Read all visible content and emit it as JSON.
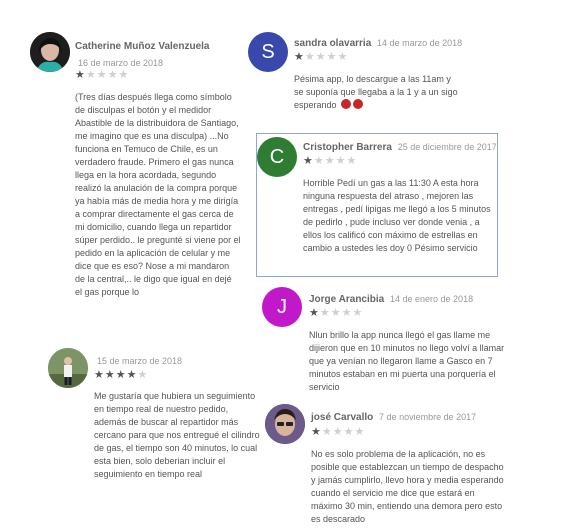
{
  "reviews": [
    {
      "name": "Catherine Muñoz Valenzuela",
      "date": "16 de marzo de 2018",
      "stars": 1,
      "text": "(Tres días después llega como símbolo de disculpas el botón y el medidor Abastible de la distribuidora de Santiago, me imagino que es una disculpa) ...No funciona en Temuco de Chile, es un verdadero fraude. Primero el gas nunca llega en la hora acordada, segundo realizó la anulación de la compra porque ya había más de media hora y me dirigía a comprar directamente el gas cerca de mi domicilio, cuando llega un repartidor súper perdido.. le pregunté si viene por el pedido en la aplicación de celular y me dice que es eso? Nose a mi mandaron de la central,.. le digo que igual en dejé el gas porque lo"
    },
    {
      "name": "",
      "date": "15 de marzo de 2018",
      "stars": 4,
      "text": "Me gustaría que hubiera un seguimiento en tiempo real de nuestro pedido, además de buscar al repartidor más cercano para que nos entregué el cilindro de gas, el tiempo son 40 minutos, lo cual esta bien, solo deberian incluir el seguimiento en tiempo real"
    },
    {
      "name": "sandra olavarria",
      "date": "14 de marzo de 2018",
      "stars": 1,
      "avatar_letter": "S",
      "avatar_color": "#3949ab",
      "text": "Pésima app, lo descargue a las 11am y se suponía que llegaba a la 1 y a un sigo esperando"
    },
    {
      "name": "Cristopher Barrera",
      "date": "25 de diciembre de 2017",
      "stars": 1,
      "avatar_letter": "C",
      "avatar_color": "#2e7d32",
      "text": "Horrible Pedí un gas a las 11:30 A esta hora ninguna respuesta del atraso , mejoren las entregas , pedí lipigas me llegó a los 5 minutos de pedirlo , pude incluso ver donde venia , a ellos los calificó con máximo de estrellas en cambio a ustedes les doy 0 Pésimo servicio"
    },
    {
      "name": "Jorge Arancibia",
      "date": "14 de enero de 2018",
      "stars": 1,
      "avatar_letter": "J",
      "avatar_color": "#c118c9",
      "text": "Nlun brillo la app nunca llegó el gas llame me dijieron que en 10 minutos no llego volví a llamar que ya venían no llegaron llame a Gasco en 7 minutos estaban en mi puerta una porquería el servicio"
    },
    {
      "name": "josé Carvallo",
      "date": "7 de noviembre de 2017",
      "stars": 1,
      "text": "No es solo problema de la aplicación, no es posible que establezcan un tiempo de despacho y jamás cumplirlo, llevo hora y media esperando cuando el servicio me dice que estará en máximo 30 min, entiendo una demora pero esto es descarado"
    }
  ]
}
